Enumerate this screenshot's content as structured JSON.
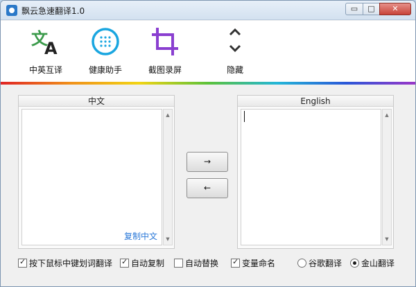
{
  "window": {
    "title": "飘云急速翻译1.0",
    "min_label": "▭",
    "max_label": "□",
    "close_label": "✕"
  },
  "toolbar": {
    "items": [
      {
        "label": "中英互译",
        "icon": "translate-icon"
      },
      {
        "label": "健康助手",
        "icon": "health-dots-icon"
      },
      {
        "label": "截图录屏",
        "icon": "crop-icon"
      },
      {
        "label": "隐藏",
        "icon": "chevron-up-down-icon"
      }
    ]
  },
  "left_panel": {
    "header": "中文",
    "text": "",
    "copy_link": "复制中文"
  },
  "right_panel": {
    "header": "English",
    "text": ""
  },
  "buttons": {
    "to_english": "→",
    "to_chinese": "←"
  },
  "options": {
    "hotkey_translate": {
      "label": "按下鼠标中键划词翻译",
      "checked": true
    },
    "auto_copy": {
      "label": "自动复制",
      "checked": true
    },
    "auto_replace": {
      "label": "自动替换",
      "checked": false
    },
    "var_naming": {
      "label": "变量命名",
      "checked": true
    },
    "engine_google": {
      "label": "谷歌翻译",
      "selected": false
    },
    "engine_jinshan": {
      "label": "金山翻译",
      "selected": true
    }
  },
  "colors": {
    "accent_blue": "#2a78d8",
    "icon_green": "#3a9a4a",
    "icon_cyan": "#1aa6e0",
    "icon_purple": "#8a3fd0"
  }
}
